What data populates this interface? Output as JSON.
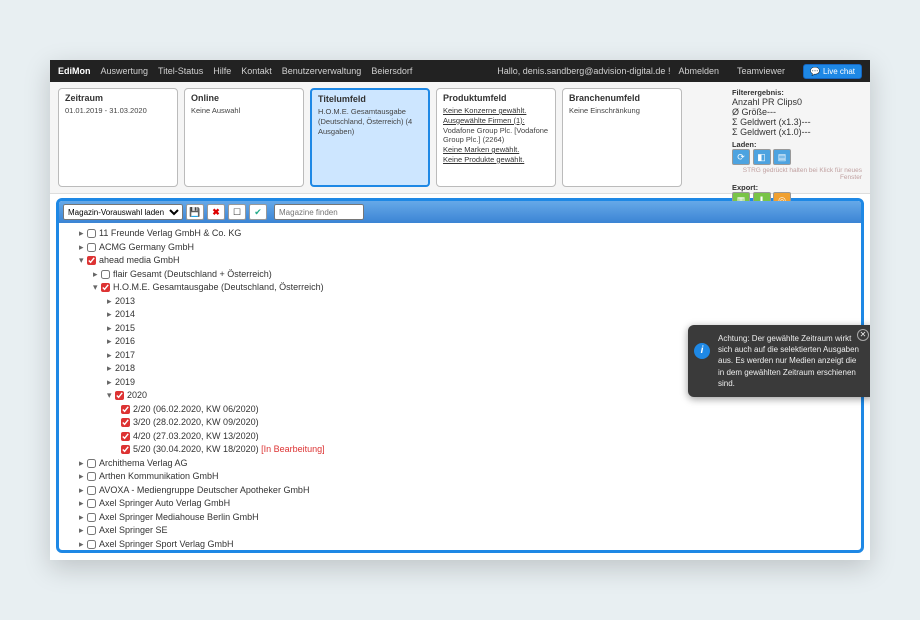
{
  "topbar": {
    "brand": "EdiMon",
    "nav": [
      "Auswertung",
      "Titel-Status",
      "Hilfe",
      "Kontakt",
      "Benutzerverwaltung",
      "Beiersdorf"
    ],
    "greeting": "Hallo, denis.sandberg@advision-digital.de !",
    "logout": "Abmelden",
    "teamviewer": "Teamviewer",
    "live_chat": "Live chat"
  },
  "filters": {
    "zeitraum": {
      "title": "Zeitraum",
      "content": "01.01.2019 - 31.03.2020"
    },
    "online": {
      "title": "Online",
      "content": "Keine Auswahl"
    },
    "titelumfeld": {
      "title": "Titelumfeld",
      "content": "H.O.M.E. Gesamtausgabe (Deutschland, Österreich) (4 Ausgaben)"
    },
    "produktumfeld": {
      "title": "Produktumfeld",
      "lines": [
        "Keine Konzerne gewählt.",
        "Ausgewählte Firmen (1):",
        "Vodafone Group Plc. [Vodafone Group Plc.] (2264)",
        "Keine Marken gewählt.",
        "Keine Produkte gewählt."
      ]
    },
    "branchenumfeld": {
      "title": "Branchenumfeld",
      "content": "Keine Einschränkung"
    }
  },
  "right_panel": {
    "filterergebnis_title": "Filterergebnis:",
    "stats": [
      {
        "label": "Anzahl PR Clips",
        "value": "0"
      },
      {
        "label": "Ø Größe",
        "value": "---"
      },
      {
        "label": "Σ Geldwert (x1.3)",
        "value": "---"
      },
      {
        "label": "Σ Geldwert (x1.0)",
        "value": "---"
      }
    ],
    "laden_title": "Laden:",
    "hint": "STRG gedrückt halten bei Klick für neues Fenster",
    "export_title": "Export:"
  },
  "toolbar": {
    "preset_placeholder": "Magazin-Vorauswahl laden",
    "search_placeholder": "Magazine finden"
  },
  "tree": {
    "publishers": [
      {
        "name": "11 Freunde Verlag GmbH & Co. KG",
        "checked": false,
        "expanded": false
      },
      {
        "name": "ACMG Germany GmbH",
        "checked": false,
        "expanded": false
      },
      {
        "name": "ahead media GmbH",
        "checked": true,
        "expanded": true,
        "red": true,
        "children": [
          {
            "name": "flair Gesamt (Deutschland + Österreich)",
            "checked": false,
            "expanded": false
          },
          {
            "name": "H.O.M.E. Gesamtausgabe (Deutschland, Österreich)",
            "checked": true,
            "expanded": true,
            "red": true,
            "years": [
              {
                "year": "2013",
                "expanded": false
              },
              {
                "year": "2014",
                "expanded": false
              },
              {
                "year": "2015",
                "expanded": false
              },
              {
                "year": "2016",
                "expanded": false
              },
              {
                "year": "2017",
                "expanded": false
              },
              {
                "year": "2018",
                "expanded": false
              },
              {
                "year": "2019",
                "expanded": false
              },
              {
                "year": "2020",
                "expanded": true,
                "checked": true,
                "issues": [
                  {
                    "label": "2/20 (06.02.2020, KW 06/2020)",
                    "checked": true
                  },
                  {
                    "label": "3/20 (28.02.2020, KW 09/2020)",
                    "checked": true
                  },
                  {
                    "label": "4/20 (27.03.2020, KW 13/2020)",
                    "checked": true
                  },
                  {
                    "label": "5/20 (30.04.2020, KW 18/2020)",
                    "checked": true,
                    "note": "[In Bearbeitung]"
                  }
                ]
              }
            ]
          }
        ]
      },
      {
        "name": "Archithema Verlag AG",
        "checked": false
      },
      {
        "name": "Arthen Kommunikation GmbH",
        "checked": false
      },
      {
        "name": "AVOXA - Mediengruppe Deutscher Apotheker GmbH",
        "checked": false
      },
      {
        "name": "Axel Springer Auto Verlag GmbH",
        "checked": false
      },
      {
        "name": "Axel Springer Mediahouse Berlin GmbH",
        "checked": false
      },
      {
        "name": "Axel Springer SE",
        "checked": false
      },
      {
        "name": "Axel Springer Sport Verlag GmbH",
        "checked": false
      }
    ]
  },
  "info_popup": {
    "text": "Achtung: Der gewählte Zeitraum wirkt sich auch auf die selektierten Ausgaben aus. Es werden nur Medien anzeigt die in dem gewählten Zeitraum erschienen sind."
  }
}
